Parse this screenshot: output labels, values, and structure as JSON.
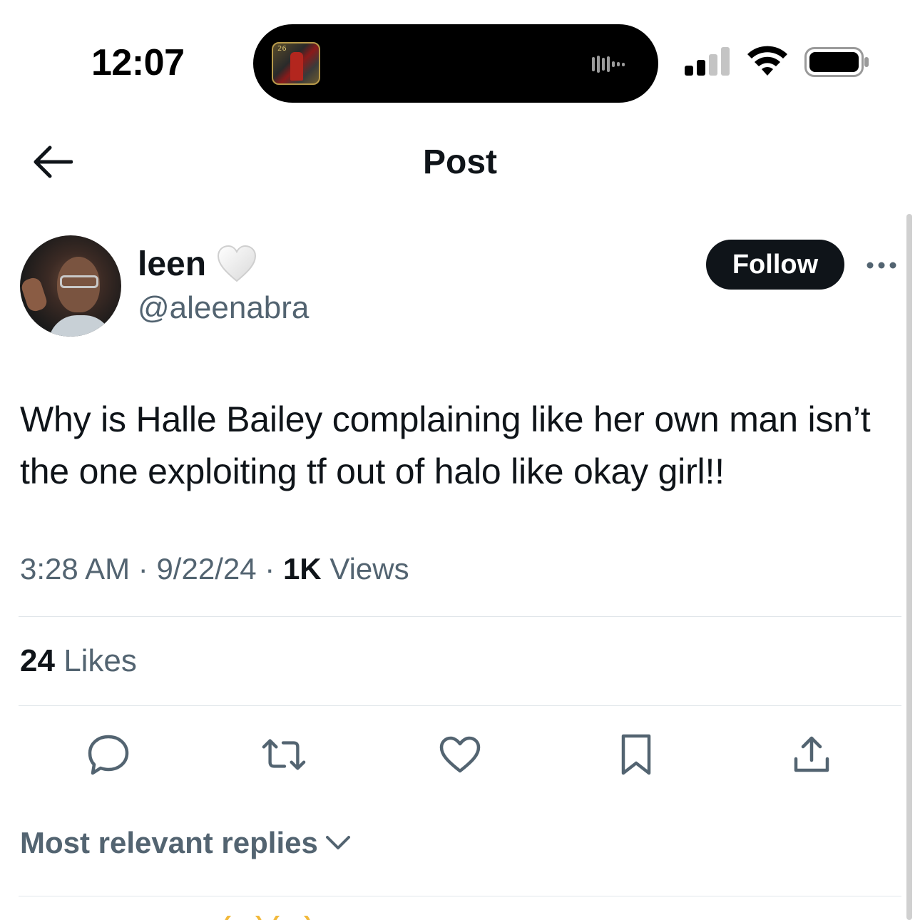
{
  "status_bar": {
    "time": "12:07",
    "island_art_label": "26"
  },
  "header": {
    "title": "Post"
  },
  "author": {
    "display_name": "leen",
    "handle": "@aleenabra",
    "follow_label": "Follow"
  },
  "tweet": {
    "text": "Why is Halle Bailey complaining like her own man isn’t the one exploiting tf out of halo like okay girl!!",
    "time": "3:28 AM",
    "date": "9/22/24",
    "views_count": "1K",
    "views_label": "Views",
    "separator": "·"
  },
  "engagement": {
    "likes_count": "24",
    "likes_label": "Likes"
  },
  "actions": [
    {
      "name": "reply-icon"
    },
    {
      "name": "repost-icon"
    },
    {
      "name": "like-icon"
    },
    {
      "name": "bookmark-icon"
    },
    {
      "name": "share-icon"
    }
  ],
  "replies": {
    "sort_label": "Most relevant replies"
  },
  "colors": {
    "text_primary": "#0f1419",
    "text_secondary": "#536471",
    "divider": "#e1e6ea",
    "follow_bg": "#0f1419"
  }
}
